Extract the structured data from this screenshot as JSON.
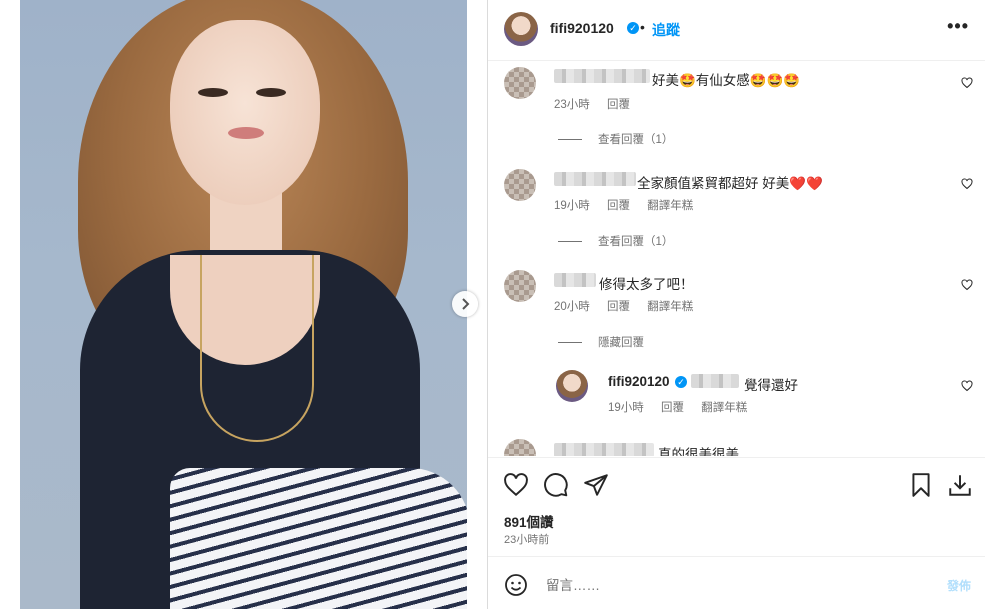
{
  "post": {
    "username": "fifi920120",
    "follow_label": "追蹤",
    "dot": "•",
    "more_label": "•••",
    "next_icon": "chevron-right-icon"
  },
  "comments": [
    {
      "text": "好美🤩有仙女感🤩🤩🤩",
      "time": "23小時",
      "reply": "回覆",
      "view_replies": "查看回覆（1）"
    },
    {
      "text": "全家顏值紧貿都超好 好美❤️❤️",
      "time": "19小時",
      "reply": "回覆",
      "translate": "翻譯年糕",
      "view_replies": "查看回覆（1）"
    },
    {
      "text": "修得太多了吧！",
      "time": "20小時",
      "reply": "回覆",
      "translate": "翻譯年糕",
      "hide_replies": "隱藏回覆"
    },
    {
      "text": "真的很美很美"
    }
  ],
  "owner_reply": {
    "username": "fifi920120",
    "text": "覺得還好",
    "time": "19小時",
    "reply": "回覆",
    "translate": "翻譯年糕"
  },
  "stats": {
    "likes": "891個讚",
    "time_ago": "23小時前"
  },
  "composer": {
    "placeholder": "留言……",
    "post_label": "發佈"
  },
  "colors": {
    "accent": "#0095f6",
    "text": "#262626",
    "muted": "#737373"
  }
}
